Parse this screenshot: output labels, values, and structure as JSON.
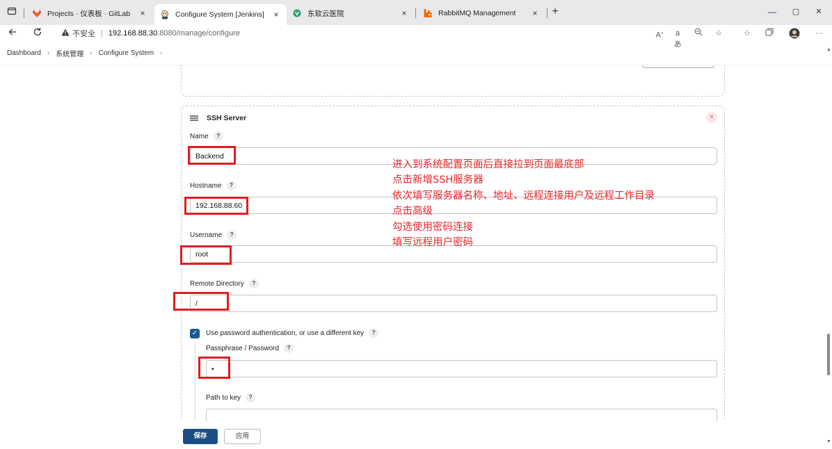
{
  "browser": {
    "tabs": [
      {
        "title": "Projects · 仪表板 · GitLab",
        "icon": "gitlab-icon",
        "active": false
      },
      {
        "title": "Configure System [Jenkins]",
        "icon": "jenkins-icon",
        "active": true
      },
      {
        "title": "东软云医院",
        "icon": "vue-icon",
        "active": false
      },
      {
        "title": "RabbitMQ Management",
        "icon": "rabbitmq-icon",
        "active": false
      }
    ],
    "close_glyph": "×",
    "new_tab_glyph": "+",
    "insecure_label": "不安全",
    "url_host": "192.168.88.30",
    "url_path": ":8080/manage/configure",
    "window_controls": [
      "—",
      "▢",
      "✕"
    ]
  },
  "breadcrumb": {
    "items": [
      "Dashboard",
      "系统管理",
      "Configure System"
    ],
    "separator": "›"
  },
  "ssh_server": {
    "title": "SSH Server",
    "close_glyph": "×",
    "help_glyph": "?",
    "name_label": "Name",
    "name_value": "Backend",
    "hostname_label": "Hostname",
    "hostname_value": "192.168.88.60",
    "username_label": "Username",
    "username_value": "root",
    "remote_dir_label": "Remote Directory",
    "remote_dir_value": "/",
    "use_password_label": "Use password authentication, or use a different key",
    "use_password_checked": true,
    "passphrase_label": "Passphrase / Password",
    "passphrase_value": "•",
    "path_to_key_label": "Path to key",
    "path_to_key_value": ""
  },
  "annotation": {
    "color": "#e8262a",
    "lines": [
      "进入到系统配置页面后直接拉到页面最底部",
      "点击新增SSH服务器",
      "依次填写服务器名称、地址、远程连接用户及远程工作目录",
      "点击高级",
      "勾选使用密码连接",
      "填写远程用户密码"
    ]
  },
  "actions": {
    "save_label": "保存",
    "apply_label": "应用"
  },
  "colors": {
    "primary": "#1a4f86",
    "highlight_box": "#e01d1d"
  }
}
